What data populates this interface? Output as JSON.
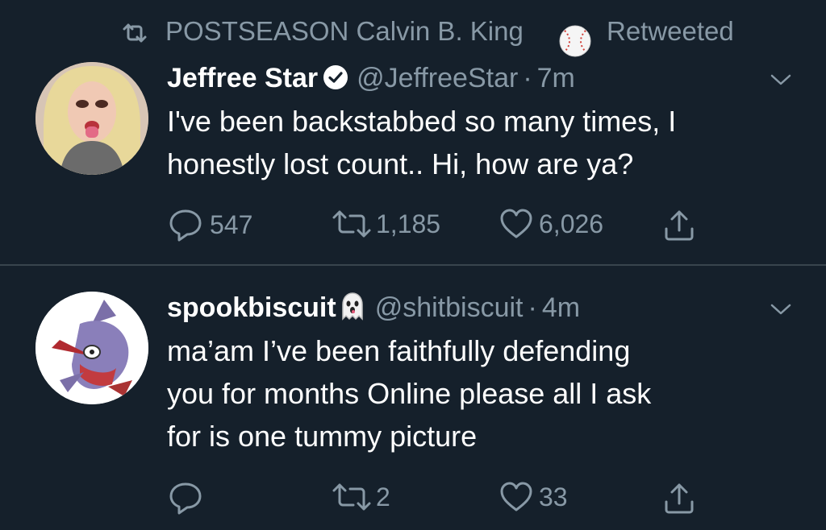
{
  "retweet_bar": {
    "text": "POSTSEASON Calvin B. King",
    "suffix": "Retweeted"
  },
  "tweets": [
    {
      "name": "Jeffree Star",
      "handle": "@JeffreeStar",
      "separator": "·",
      "time": "7m",
      "text_lines": [
        "I've been backstabbed so many times, I",
        "honestly lost count.. Hi, how are ya?"
      ],
      "replies": "547",
      "retweets": "1,185",
      "likes": "6,026"
    },
    {
      "name": "spookbiscuit",
      "handle": "@shitbiscuit",
      "separator": "·",
      "time": "4m",
      "text_lines": [
        "ma’am I’ve been faithfully defending",
        "you for months Online please all I ask",
        "for is one tummy picture"
      ],
      "replies": "",
      "retweets": "2",
      "likes": "33"
    }
  ],
  "colors": {
    "background": "#15202b",
    "secondary_text": "#8899a6",
    "primary_text": "#ffffff",
    "divider": "#38444d"
  },
  "icons": [
    "retweet-icon",
    "baseball-emoji-icon",
    "verified-badge-icon",
    "ghost-emoji-icon",
    "chevron-down-icon",
    "reply-icon",
    "like-icon",
    "share-icon"
  ]
}
